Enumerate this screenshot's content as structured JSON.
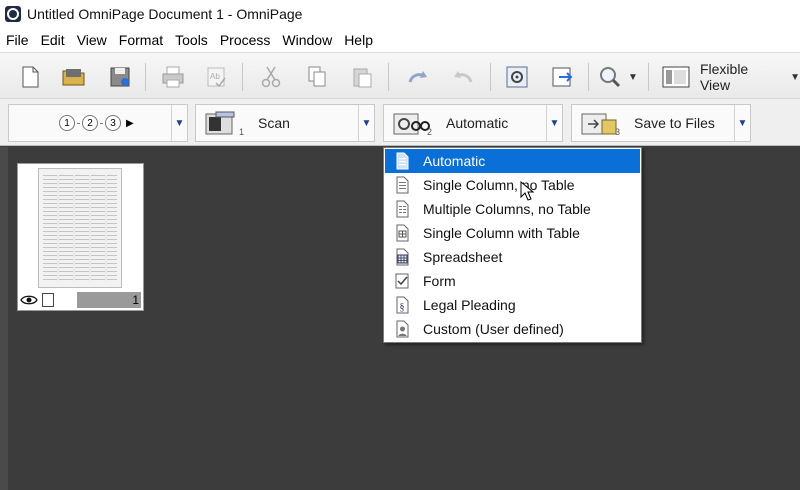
{
  "window": {
    "title": "Untitled OmniPage Document 1 - OmniPage"
  },
  "menu": {
    "items": [
      "File",
      "Edit",
      "View",
      "Format",
      "Tools",
      "Process",
      "Window",
      "Help"
    ]
  },
  "toolbar": {
    "view_mode_label": "Flexible View"
  },
  "workflow": {
    "steps": [
      "1",
      "2",
      "3"
    ],
    "scan": {
      "number": "1",
      "label": "Scan"
    },
    "recognize": {
      "number": "2",
      "label": "Automatic"
    },
    "export": {
      "number": "3",
      "label": "Save to Files"
    }
  },
  "thumbnail": {
    "page_number": "1"
  },
  "layout_menu": {
    "selected_index": 0,
    "items": [
      {
        "label": "Automatic",
        "icon": "automatic-layout-icon"
      },
      {
        "label": "Single Column, no Table",
        "icon": "single-column-icon"
      },
      {
        "label": "Multiple Columns, no Table",
        "icon": "multiple-columns-icon"
      },
      {
        "label": "Single Column with Table",
        "icon": "column-with-table-icon"
      },
      {
        "label": "Spreadsheet",
        "icon": "spreadsheet-icon"
      },
      {
        "label": "Form",
        "icon": "form-icon"
      },
      {
        "label": "Legal Pleading",
        "icon": "legal-pleading-icon"
      },
      {
        "label": "Custom (User defined)",
        "icon": "custom-user-icon"
      }
    ]
  },
  "colors": {
    "selection": "#0a6fd6",
    "workspace": "#3c3c3c",
    "accent_arrow": "#1f3f8f"
  }
}
